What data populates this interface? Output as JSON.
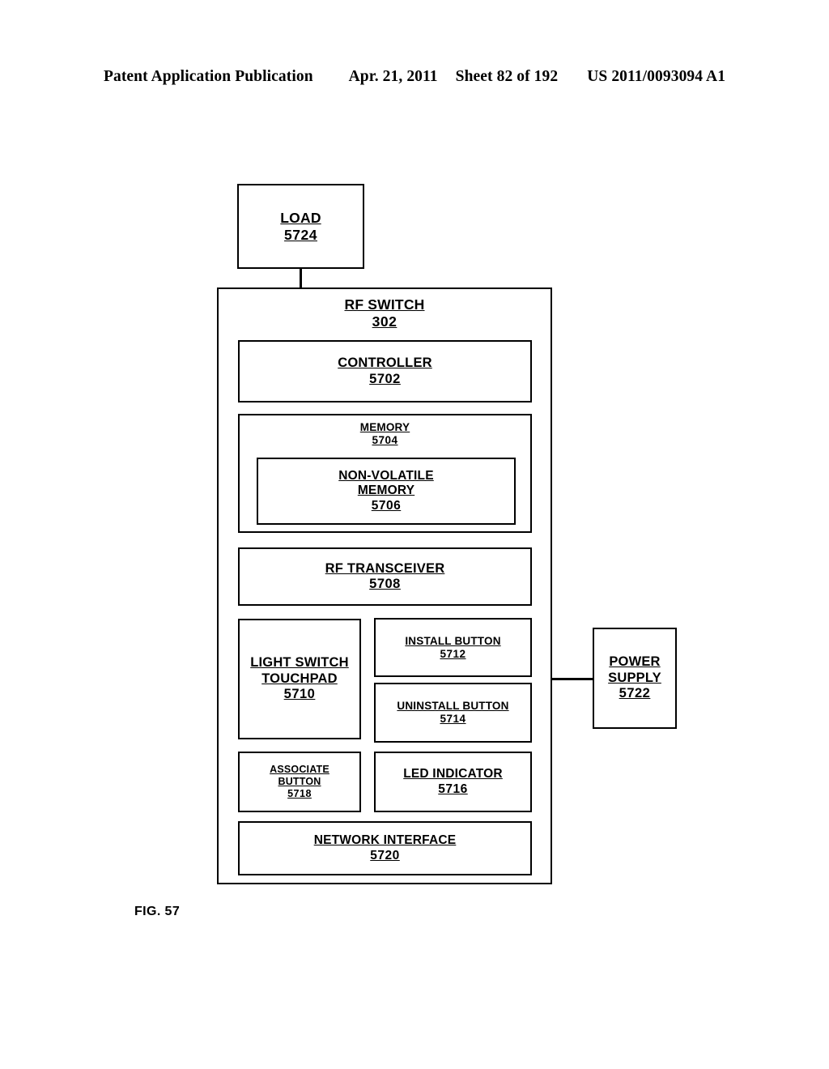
{
  "header": {
    "publication": "Patent Application Publication",
    "date": "Apr. 21, 2011",
    "sheet": "Sheet 82 of 192",
    "patent_number": "US 2011/0093094 A1"
  },
  "figure": {
    "caption": "FIG. 57",
    "blocks": {
      "load": {
        "title": "LOAD",
        "ref": "5724"
      },
      "rf_switch": {
        "title": "RF SWITCH",
        "ref": "302"
      },
      "controller": {
        "title": "CONTROLLER",
        "ref": "5702"
      },
      "memory": {
        "title": "MEMORY",
        "ref": "5704"
      },
      "non_volatile_memory": {
        "title_line1": "NON-VOLATILE",
        "title_line2": "MEMORY",
        "ref": "5706"
      },
      "rf_transceiver": {
        "title": "RF TRANSCEIVER",
        "ref": "5708"
      },
      "light_switch_touchpad": {
        "title_line1": "LIGHT SWITCH",
        "title_line2": "TOUCHPAD",
        "ref": "5710"
      },
      "install_button": {
        "title": "INSTALL BUTTON",
        "ref": "5712"
      },
      "uninstall_button": {
        "title": "UNINSTALL BUTTON",
        "ref": "5714"
      },
      "associate_button": {
        "title_line1": "ASSOCIATE",
        "title_line2": "BUTTON",
        "ref": "5718"
      },
      "led_indicator": {
        "title": "LED INDICATOR",
        "ref": "5716"
      },
      "network_interface": {
        "title": "NETWORK INTERFACE",
        "ref": "5720"
      },
      "power_supply": {
        "title_line1": "POWER",
        "title_line2": "SUPPLY",
        "ref": "5722"
      }
    }
  }
}
